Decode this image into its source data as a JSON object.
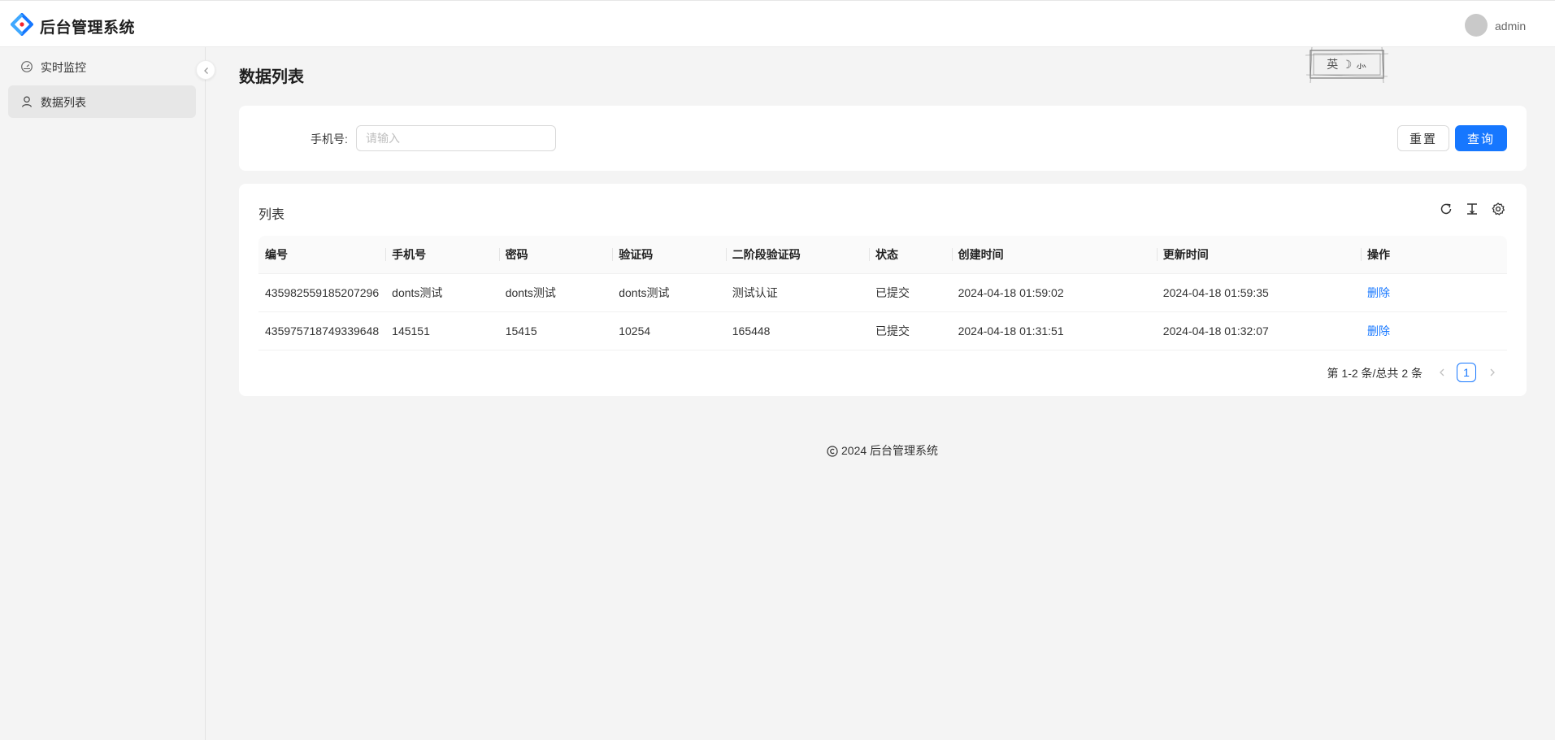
{
  "header": {
    "app_title": "后台管理系统",
    "username": "admin",
    "logo_icon": "diamond-logo-icon",
    "brand_colors": {
      "blue": "#1677ff",
      "red": "#f5222d"
    }
  },
  "sidebar": {
    "items": [
      {
        "label": "实时监控",
        "icon": "dashboard-icon",
        "active": false
      },
      {
        "label": "数据列表",
        "icon": "user-icon",
        "active": true
      }
    ],
    "collapse_icon": "chevron-left-icon"
  },
  "main": {
    "page_title": "数据列表",
    "stamp_text": "英 ☽ ⺗"
  },
  "search": {
    "phone_label": "手机号:",
    "phone_placeholder": "请输入",
    "phone_value": "",
    "reset_label": "重置",
    "query_label": "查询"
  },
  "table": {
    "card_title": "列表",
    "tools": [
      "reload-icon",
      "density-icon",
      "settings-icon"
    ],
    "columns": [
      "编号",
      "手机号",
      "密码",
      "验证码",
      "二阶段验证码",
      "状态",
      "创建时间",
      "更新时间",
      "操作"
    ],
    "rows": [
      {
        "id": "435982559185207296",
        "phone": "donts测试",
        "password": "donts测试",
        "code": "donts测试",
        "code2": "测试认证",
        "status": "已提交",
        "created": "2024-04-18 01:59:02",
        "updated": "2024-04-18 01:59:35",
        "action": "删除"
      },
      {
        "id": "435975718749339648",
        "phone": "145151",
        "password": "15415",
        "code": "10254",
        "code2": "165448",
        "status": "已提交",
        "created": "2024-04-18 01:31:51",
        "updated": "2024-04-18 01:32:07",
        "action": "删除"
      }
    ]
  },
  "pagination": {
    "total_text": "第 1-2 条/总共 2 条",
    "current_page": "1"
  },
  "footer": {
    "text": "2024 后台管理系统"
  }
}
